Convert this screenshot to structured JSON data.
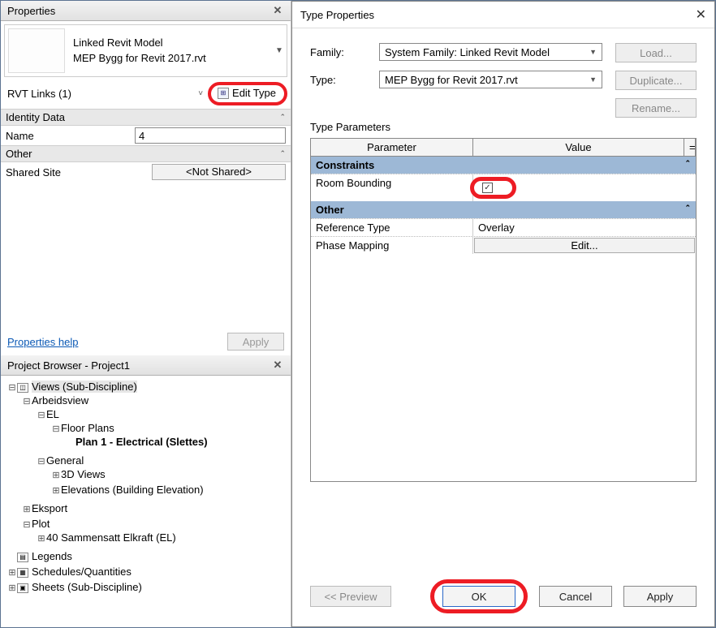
{
  "properties": {
    "title": "Properties",
    "linked_model_label": "Linked Revit Model",
    "linked_model_file": "MEP Bygg for Revit 2017.rvt",
    "rvt_links_label": "RVT Links (1)",
    "edit_type_label": "Edit Type",
    "identity_data_label": "Identity Data",
    "name_label": "Name",
    "name_value": "4",
    "other_label": "Other",
    "shared_site_label": "Shared Site",
    "shared_site_value": "<Not Shared>",
    "help_link": "Properties help",
    "apply_label": "Apply"
  },
  "browser": {
    "title": "Project Browser - Project1",
    "items": {
      "views_root": "Views (Sub-Discipline)",
      "arbeidsview": "Arbeidsview",
      "el": "EL",
      "floor_plans": "Floor Plans",
      "plan1": "Plan 1 - Electrical (Slettes)",
      "general": "General",
      "views3d": "3D Views",
      "elevations": "Elevations (Building Elevation)",
      "eksport": "Eksport",
      "plot": "Plot",
      "sammensatt": "40 Sammensatt Elkraft (EL)",
      "legends": "Legends",
      "schedules": "Schedules/Quantities",
      "sheets": "Sheets (Sub-Discipline)"
    }
  },
  "dialog": {
    "title": "Type Properties",
    "family_label": "Family:",
    "family_value": "System Family: Linked Revit Model",
    "type_label": "Type:",
    "type_value": "MEP Bygg for Revit 2017.rvt",
    "load_label": "Load...",
    "duplicate_label": "Duplicate...",
    "rename_label": "Rename...",
    "type_parameters_label": "Type Parameters",
    "param_header": "Parameter",
    "value_header": "Value",
    "constraints_group": "Constraints",
    "room_bounding_label": "Room Bounding",
    "room_bounding_checked": "✓",
    "other_group": "Other",
    "reference_type_label": "Reference Type",
    "reference_type_value": "Overlay",
    "phase_mapping_label": "Phase Mapping",
    "phase_mapping_value": "Edit...",
    "preview_label": "<< Preview",
    "ok_label": "OK",
    "cancel_label": "Cancel",
    "apply_label": "Apply"
  }
}
